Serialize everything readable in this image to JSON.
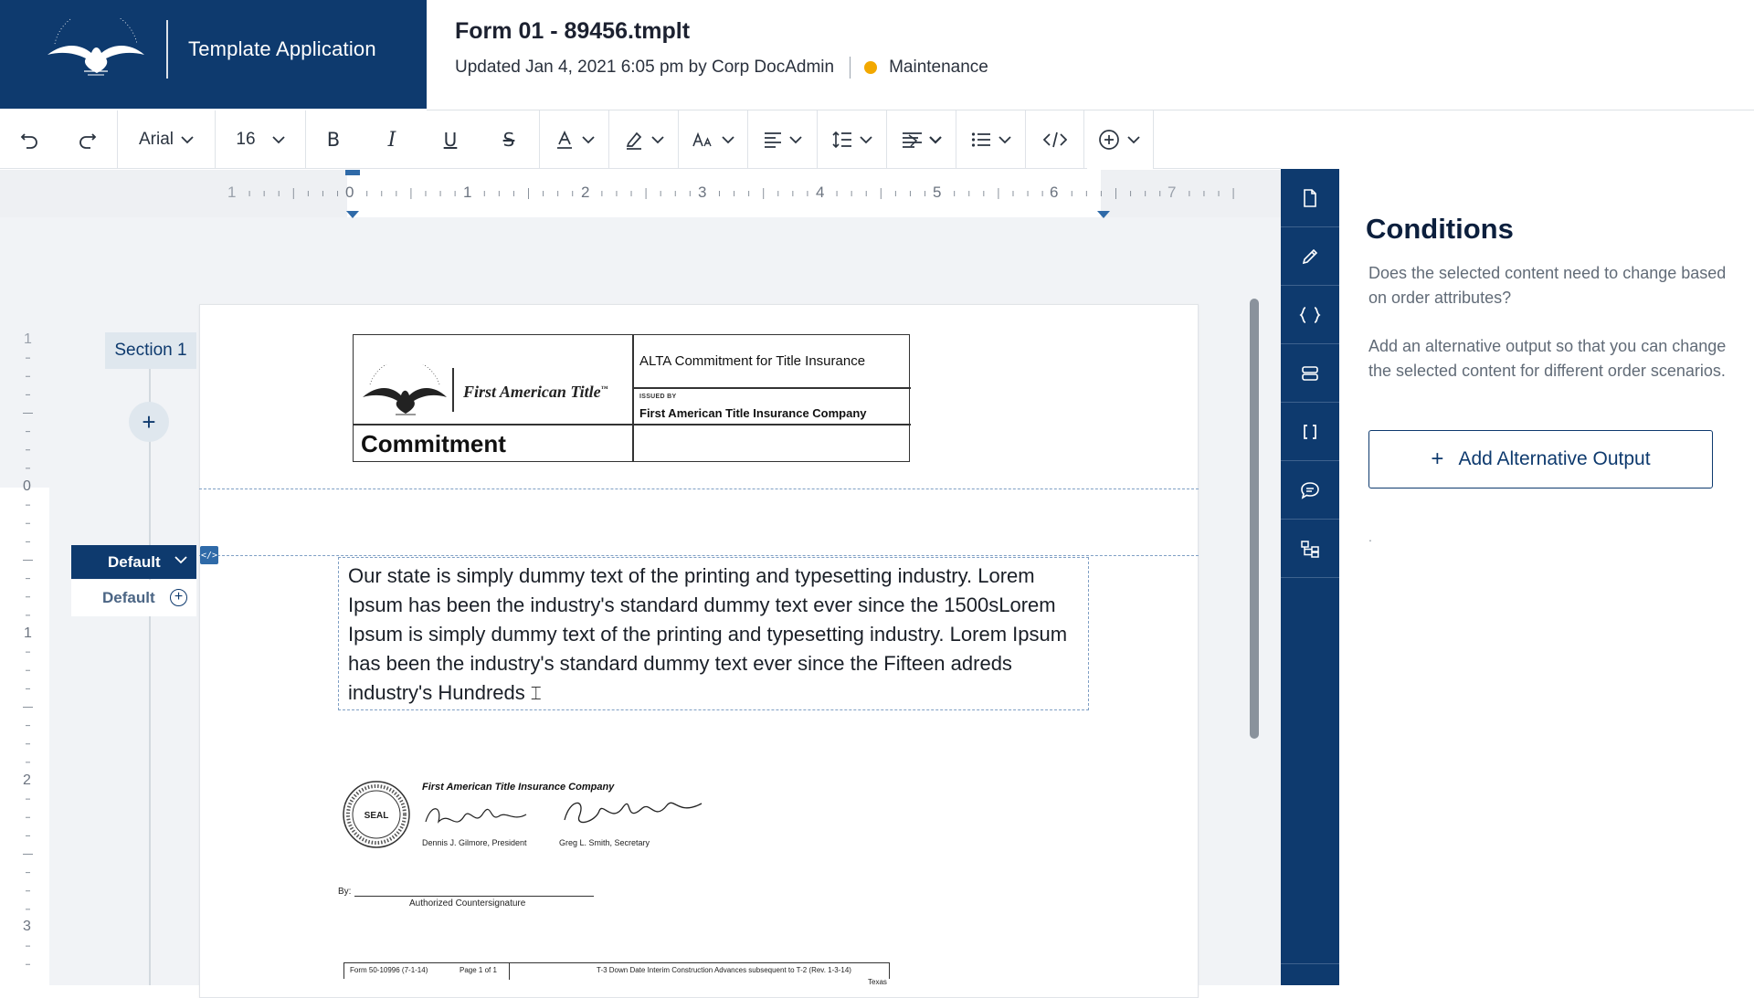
{
  "brand": {
    "app_name": "Template Application"
  },
  "document": {
    "title": "Form 01 - 89456.tmplt",
    "updated": "Updated Jan 4, 2021 6:05 pm by Corp DocAdmin",
    "status": "Maintenance",
    "status_color": "#f2a800"
  },
  "toolbar": {
    "undo_icon": "undo-icon",
    "redo_icon": "redo-icon",
    "font_family": "Arial",
    "font_size": "16",
    "bold_icon": "B",
    "italic_icon": "I",
    "underline_icon": "U",
    "strikethrough_icon": "S"
  },
  "ruler": {
    "horizontal_labels": [
      "1",
      "0",
      "1",
      "2",
      "3",
      "4",
      "5",
      "6",
      "7"
    ],
    "vertical_labels": [
      "1",
      "0",
      "1",
      "2",
      "3"
    ]
  },
  "outline": {
    "section_label": "Section 1",
    "variant_selected": "Default",
    "variant_item": "Default"
  },
  "content": {
    "body_text": "Our state is simply dummy text of the printing and typesetting industry. Lorem Ipsum has been the industry's standard dummy text ever since the 1500sLorem Ipsum is simply dummy text of the printing and typesetting industry. Lorem Ipsum has been the industry's standard dummy text ever since the Fifteen adreds industry's Hundreds"
  },
  "doc_art": {
    "logo_text": "First American Title",
    "trademark": "™",
    "commitment": "Commitment",
    "alta_title": "ALTA Commitment for Title Insurance",
    "issued_by": "ISSUED BY",
    "company": "First American Title Insurance Company",
    "sig_company": "First American Title Insurance Company",
    "sig_name1": "Dennis J. Gilmore, President",
    "sig_name2": "Greg L. Smith, Secretary",
    "seal_text": "SEAL",
    "by_label": "By:",
    "countersignature": "Authorized Countersignature",
    "footer_form": "Form 50-10996 (7-1-14)",
    "footer_page": "Page 1 of 1",
    "footer_desc": "T-3 Down Date Interim Construction Advances subsequent to T-2 (Rev. 1-3-14)",
    "footer_state": "Texas"
  },
  "panel": {
    "title": "Conditions",
    "p1": "Does the selected content need to change based on order attributes?",
    "p2": "Add an alternative output so that you can change the selected content for different order scenarios.",
    "button_label": "Add Alternative Output",
    "trailing": "."
  },
  "rail_icons": [
    "document-icon",
    "pencil-icon",
    "braces-icon",
    "database-icon",
    "brackets-icon",
    "comment-icon",
    "hierarchy-icon"
  ],
  "colors": {
    "brand": "#0e3a6e",
    "accent": "#f2a800"
  }
}
